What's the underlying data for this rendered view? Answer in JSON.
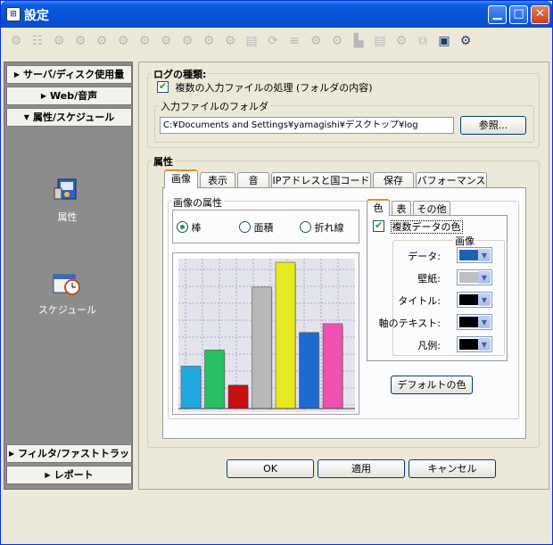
{
  "window": {
    "title": "設定"
  },
  "leftnav": {
    "server": "サーバ/ディスク使用量",
    "web": "Web/音声",
    "attributes": "属性/スケジュール",
    "filter": "フィルタ/ファストトラッカ",
    "report": "レポート",
    "icon_attr_label": "属性",
    "icon_schedule_label": "スケジュール"
  },
  "logtype": {
    "title": "ログの種類:",
    "multi_input_label": "複数の入力ファイルの処理 (フォルダの内容)",
    "folder_group_title": "入力ファイルのフォルダ",
    "folder_path": "C:¥Documents and Settings¥yamagishi¥デスクトップ¥log",
    "browse_button": "参照..."
  },
  "attributes": {
    "title": "属性",
    "tabs": [
      "画像",
      "表示",
      "音",
      "IPアドレスと国コード",
      "保存",
      "パフォーマンス"
    ],
    "image_group_title": "画像の属性",
    "radio_bar": "棒",
    "radio_area": "面積",
    "radio_line": "折れ線",
    "subtabs": [
      "色",
      "表",
      "その他"
    ],
    "multi_data_color": "複数データの色",
    "image_sub_title": "画像",
    "rows": [
      {
        "label": "データ:",
        "color": "#2060b0"
      },
      {
        "label": "壁紙:",
        "color": "#c0c0c0"
      },
      {
        "label": "タイトル:",
        "color": "#000000"
      },
      {
        "label": "軸のテキスト:",
        "color": "#000000"
      },
      {
        "label": "凡例:",
        "color": "#000000"
      }
    ],
    "default_color_button": "デフォルトの色"
  },
  "preview_bars": {
    "colors": [
      "#22a8e0",
      "#28c060",
      "#c81010",
      "#b8b8b8",
      "#e8e820",
      "#1c6cd0",
      "#f050b0"
    ],
    "values": [
      0.29,
      0.4,
      0.16,
      0.83,
      1.0,
      0.52,
      0.58
    ]
  },
  "footer": {
    "ok": "OK",
    "apply": "適用",
    "cancel": "キャンセル"
  }
}
